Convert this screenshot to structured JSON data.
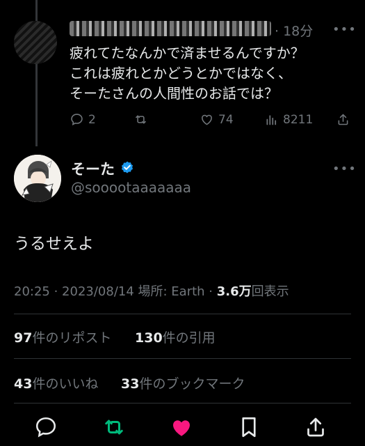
{
  "reply": {
    "time": "· 18分",
    "more": "•••",
    "lines": [
      "疲れてたなんかで済ませるんですか？",
      "これは疲れとかどうとかではなく、",
      "そーたさんの人間性のお話では？"
    ],
    "actions": {
      "reply_count": "2",
      "retweet_count": "",
      "like_count": "74",
      "view_count": "8211"
    }
  },
  "main": {
    "display_name": "そーた",
    "handle": "@sooootaaaaaaa",
    "more": "•••",
    "text": "うるせえよ",
    "meta": {
      "time": "20:25 · 2023/08/14 場所: Earth ·",
      "views": "3.6万",
      "views_label": "回表示"
    },
    "stats": {
      "reposts": "97",
      "reposts_label": "件のリポスト",
      "quotes": "130",
      "quotes_label": "件の引用",
      "likes": "43",
      "likes_label": "件のいいね",
      "bookmarks": "33",
      "bookmarks_label": "件のブックマーク"
    }
  },
  "colors": {
    "background": "#000000",
    "text": "#e7e9ea",
    "muted": "#71767b",
    "divider": "#2f3336",
    "retweet_active": "#00ba7c",
    "like_active": "#f91880",
    "verified": "#1d9bf0"
  }
}
